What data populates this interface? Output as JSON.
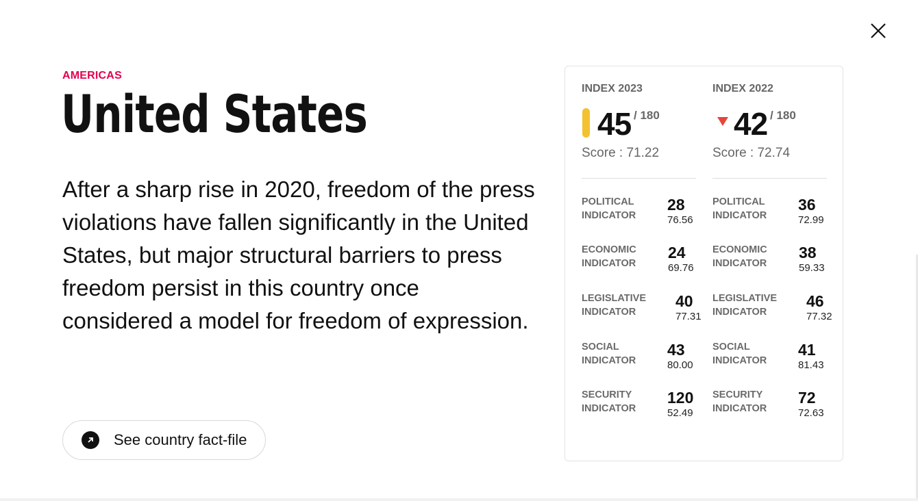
{
  "region": "AMERICAS",
  "country": "United States",
  "summary": "After a sharp rise in 2020, freedom of the press violations have fallen significantly in the United States, but major structural barriers to press freedom persist in this country once considered a model for freedom of expression.",
  "fact_file_label": "See country fact-file",
  "colors": {
    "region": "#e3004f",
    "pill": "#f2c230",
    "down_arrow": "#e8453c"
  },
  "index_2023": {
    "label": "INDEX 2023",
    "rank": "45",
    "of": "/ 180",
    "score": "Score : 71.22",
    "indicators": [
      {
        "name": "POLITICAL INDICATOR",
        "rank": "28",
        "score": "76.56"
      },
      {
        "name": "ECONOMIC INDICATOR",
        "rank": "24",
        "score": "69.76"
      },
      {
        "name": "LEGISLATIVE INDICATOR",
        "rank": "40",
        "score": "77.31"
      },
      {
        "name": "SOCIAL INDICATOR",
        "rank": "43",
        "score": "80.00"
      },
      {
        "name": "SECURITY INDICATOR",
        "rank": "120",
        "score": "52.49"
      }
    ]
  },
  "index_2022": {
    "label": "INDEX 2022",
    "rank": "42",
    "of": "/ 180",
    "score": "Score : 72.74",
    "indicators": [
      {
        "name": "POLITICAL INDICATOR",
        "rank": "36",
        "score": "72.99"
      },
      {
        "name": "ECONOMIC INDICATOR",
        "rank": "38",
        "score": "59.33"
      },
      {
        "name": "LEGISLATIVE INDICATOR",
        "rank": "46",
        "score": "77.32"
      },
      {
        "name": "SOCIAL INDICATOR",
        "rank": "41",
        "score": "81.43"
      },
      {
        "name": "SECURITY INDICATOR",
        "rank": "72",
        "score": "72.63"
      }
    ]
  }
}
